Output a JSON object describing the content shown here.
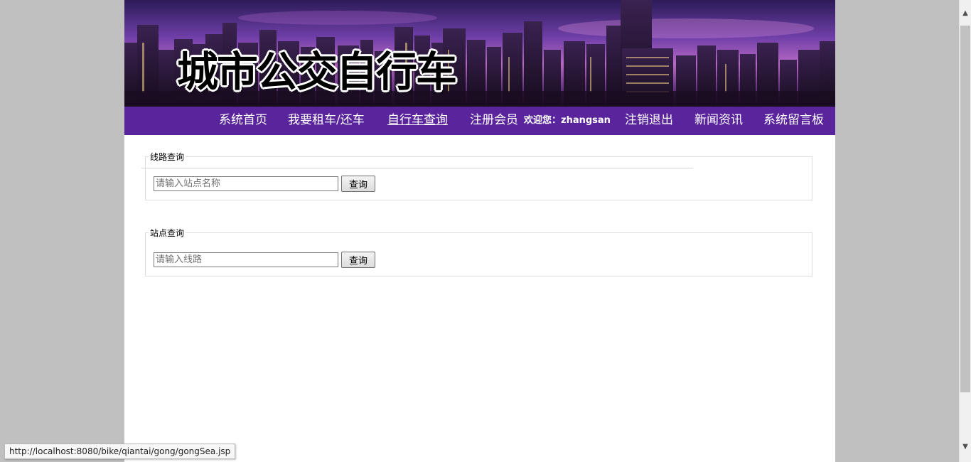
{
  "banner": {
    "title": "城市公交自行车"
  },
  "nav": {
    "items": [
      {
        "label": "系统首页"
      },
      {
        "label": "我要租车/还车"
      },
      {
        "label": "自行车查询",
        "active": true
      },
      {
        "label": "注册会员"
      },
      {
        "label": "注销退出"
      },
      {
        "label": "新闻资讯"
      },
      {
        "label": "系统留言板"
      }
    ],
    "welcome": "欢迎您：zhangsan"
  },
  "route_search": {
    "legend": "线路查询",
    "placeholder": "请输入站点名称",
    "button": "查询"
  },
  "station_search": {
    "legend": "站点查询",
    "placeholder": "请输入线路",
    "button": "查询"
  },
  "status_bar": {
    "url": "http://localhost:8080/bike/qiantai/gong/gongSea.jsp"
  },
  "colors": {
    "nav_bg": "#5a259c",
    "page_bg": "#c0c0c0",
    "content_bg": "#ffffff"
  }
}
